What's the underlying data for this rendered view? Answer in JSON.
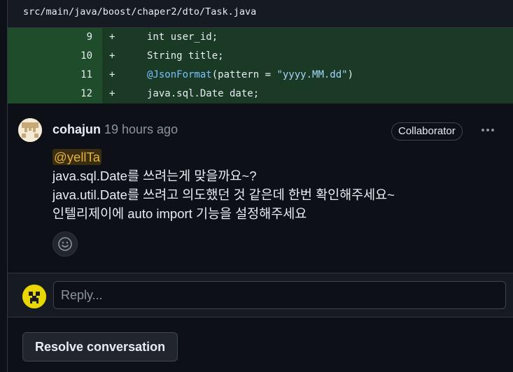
{
  "file": {
    "path": "src/main/java/boost/chaper2/dto/Task.java"
  },
  "diff": {
    "lines": [
      {
        "number": "9",
        "marker": "+",
        "code": "int user_id;"
      },
      {
        "number": "10",
        "marker": "+",
        "code": "String title;"
      },
      {
        "number": "11",
        "marker": "+",
        "annotation": "@JsonFormat",
        "code_pre": "(pattern = ",
        "string": "\"yyyy.MM.dd\"",
        "code_post": ")"
      },
      {
        "number": "12",
        "marker": "+",
        "code": "java.sql.Date date;"
      }
    ]
  },
  "comment": {
    "author": "cohajun",
    "time": "19 hours ago",
    "badge": "Collaborator",
    "more_icon": "kebab-horizontal-icon",
    "mention": "@yellTa",
    "lines": [
      "java.sql.Date를 쓰려는게 맞을까요~?",
      "java.util.Date를 쓰려고 의도했던 것 같은데 한번 확인해주세요~",
      "인텔리제이에 auto import 기능을 설정해주세요"
    ],
    "reaction_icon": "smiley-icon"
  },
  "reply": {
    "placeholder": "Reply..."
  },
  "actions": {
    "resolve_label": "Resolve conversation"
  },
  "colors": {
    "added_line_bg": "#1b3a26",
    "added_number_bg": "#1f4d2b",
    "mention": "#e3b341",
    "page_bg": "#0d1117"
  }
}
